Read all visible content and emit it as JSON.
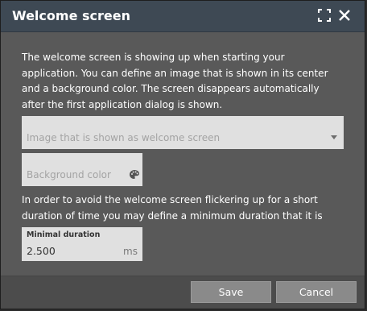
{
  "dialog": {
    "title": "Welcome screen",
    "icons": {
      "expand": "expand-icon",
      "close": "close-icon"
    }
  },
  "description": "The welcome screen is showing up when starting your application. You can define an image that is shown in its center and a background color. The screen disappears automatically after the first application dialog is shown.",
  "image_field": {
    "placeholder": "Image that is shown as welcome screen",
    "icon": "chevron-down-icon"
  },
  "color_field": {
    "placeholder": "Background color",
    "icon": "palette-icon"
  },
  "description2": "In order to avoid the welcome screen flickering up for a short duration of time you may define a minimum duration that it is shown.",
  "duration_field": {
    "label": "Minimal duration",
    "value": "2.500",
    "unit": "ms"
  },
  "buttons": {
    "save": "Save",
    "cancel": "Cancel"
  },
  "colors": {
    "titlebar": "#3e4954",
    "body": "#595959",
    "field": "#e0e0e0",
    "button": "#8a8a8a"
  }
}
